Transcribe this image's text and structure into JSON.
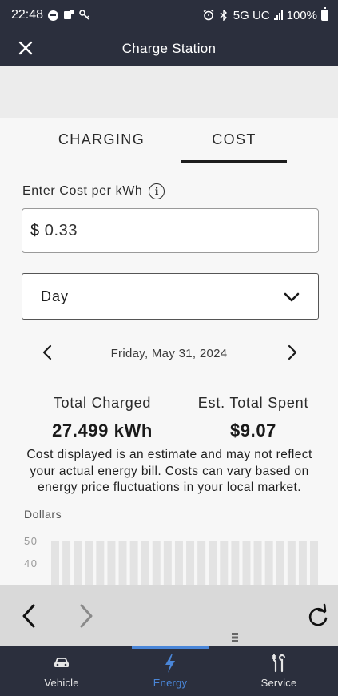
{
  "status_bar": {
    "time": "22:48",
    "network": "5G UC",
    "battery": "100%",
    "icons": [
      "do-not-disturb-icon",
      "notification-icon",
      "key-icon",
      "alarm-icon",
      "bluetooth-icon",
      "signal-icon",
      "battery-icon"
    ]
  },
  "header": {
    "title": "Charge Station",
    "close_icon": "close-icon"
  },
  "tabs": [
    {
      "label": "CHARGING",
      "active": false
    },
    {
      "label": "COST",
      "active": true
    }
  ],
  "cost_input": {
    "label": "Enter Cost per kWh",
    "currency": "$",
    "value": "0.33"
  },
  "period_select": {
    "selected": "Day"
  },
  "date_nav": {
    "date": "Friday, May 31, 2024"
  },
  "stats": {
    "total_charged_label": "Total Charged",
    "total_charged_value": "27.499 kWh",
    "total_spent_label": "Est. Total Spent",
    "total_spent_value": "$9.07"
  },
  "disclaimer": "Cost displayed is an estimate and may not reflect your actual energy bill. Costs can vary based on energy price fluctuations in your local market.",
  "chart": {
    "y_unit": "Dollars",
    "y_ticks": [
      "50",
      "40"
    ],
    "bar_count": 24
  },
  "bottom_nav": {
    "items": [
      {
        "label": "Vehicle",
        "icon": "car-icon",
        "active": false
      },
      {
        "label": "Energy",
        "icon": "lightning-icon",
        "active": true
      },
      {
        "label": "Service",
        "icon": "tools-icon",
        "active": false
      }
    ]
  },
  "colors": {
    "header_bg": "#2b2f3d",
    "accent": "#4a86d8",
    "browser_bar": "#d9d9d9"
  }
}
